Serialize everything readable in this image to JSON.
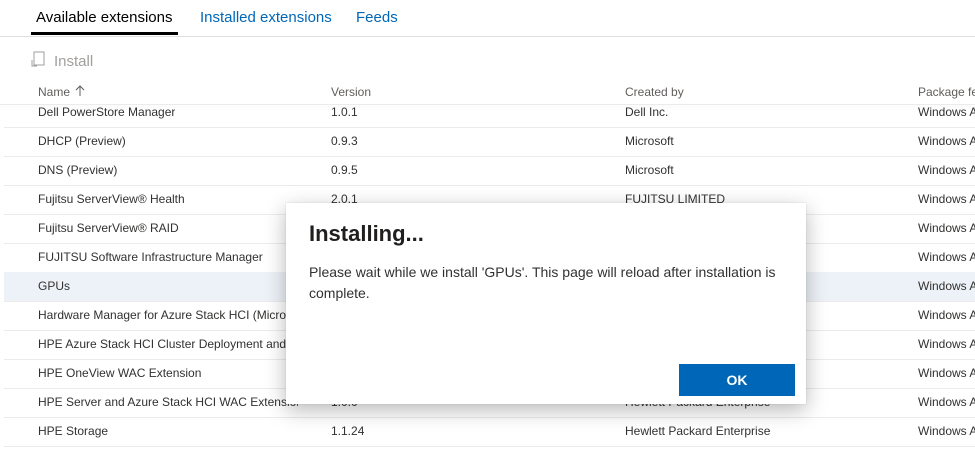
{
  "tabs": [
    {
      "label": "Available extensions"
    },
    {
      "label": "Installed extensions"
    },
    {
      "label": "Feeds"
    }
  ],
  "toolbar": {
    "install_label": "Install",
    "install_icon": "install-icon"
  },
  "columns": {
    "name": "Name",
    "sort_icon": "sort-ascending-icon",
    "version": "Version",
    "created_by": "Created by",
    "package_feed": "Package fe"
  },
  "rows": [
    {
      "name": "Dell PowerStore Manager",
      "version": "1.0.1",
      "created_by": "Dell Inc.",
      "feed": "Windows A"
    },
    {
      "name": "DHCP (Preview)",
      "version": "0.9.3",
      "created_by": "Microsoft",
      "feed": "Windows A"
    },
    {
      "name": "DNS (Preview)",
      "version": "0.9.5",
      "created_by": "Microsoft",
      "feed": "Windows A"
    },
    {
      "name": "Fujitsu ServerView® Health",
      "version": "2.0.1",
      "created_by": "FUJITSU LIMITED",
      "feed": "Windows A"
    },
    {
      "name": "Fujitsu ServerView® RAID",
      "version": "",
      "created_by": "",
      "feed": "Windows A"
    },
    {
      "name": "FUJITSU Software Infrastructure Manager",
      "version": "",
      "created_by": "",
      "feed": "Windows A"
    },
    {
      "name": "GPUs",
      "version": "",
      "created_by": "",
      "feed": "Windows A",
      "selected": true
    },
    {
      "name": "Hardware Manager for Azure Stack HCI (Microso",
      "version": "",
      "created_by": "",
      "feed": "Windows A"
    },
    {
      "name": "HPE Azure Stack HCI Cluster Deployment and Up",
      "version": "",
      "created_by": "",
      "feed": "Windows A"
    },
    {
      "name": "HPE OneView WAC Extension",
      "version": "",
      "created_by": "",
      "feed": "Windows A"
    },
    {
      "name": "HPE Server and Azure Stack HCI WAC Extensions",
      "version": "1.0.0",
      "created_by": "Hewlett Packard Enterprise",
      "feed": "Windows A"
    },
    {
      "name": "HPE Storage",
      "version": "1.1.24",
      "created_by": "Hewlett Packard Enterprise",
      "feed": "Windows A"
    }
  ],
  "dialog": {
    "title": "Installing...",
    "message": "Please wait while we install 'GPUs'. This page will reload after installation is complete.",
    "ok_label": "OK"
  },
  "colors": {
    "accent": "#0067b8",
    "selected_row": "#edf2f8"
  }
}
